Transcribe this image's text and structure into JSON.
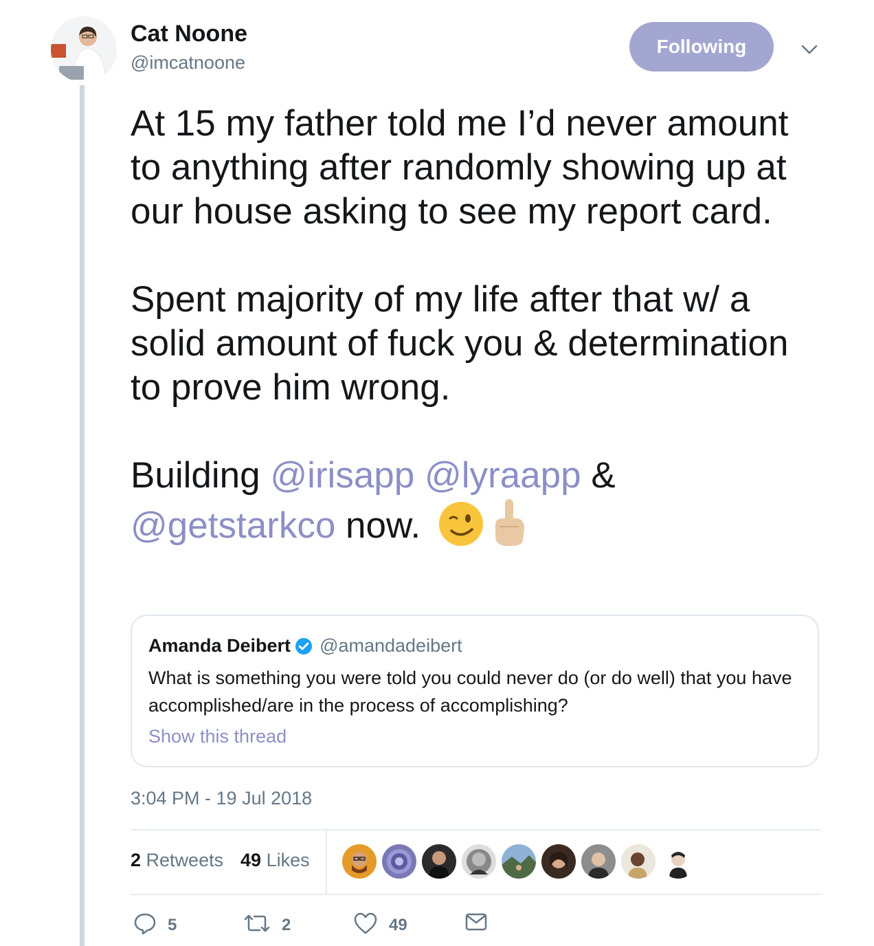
{
  "author": {
    "name": "Cat Noone",
    "handle": "@imcatnoone",
    "follow_label": "Following"
  },
  "tweet": {
    "paragraph1": "At 15 my father told me I’d never amount to anything after randomly showing up at our house asking to see my report card.",
    "paragraph2": "Spent majority of my life after that w/ a solid amount of fuck you & determination to prove him wrong.",
    "paragraph3": {
      "prefix": "Building ",
      "mention1": "@irisapp",
      "mention2": "@lyraapp",
      "joiner": " & ",
      "mention3": "@getstarkco",
      "suffix": " now. "
    },
    "emojis": [
      "winking-face-emoji",
      "middle-finger-emoji"
    ]
  },
  "quoted_tweet": {
    "name": "Amanda Deibert",
    "handle": "@amandadeibert",
    "text": "What is something you were told you could never do (or do well) that you have accomplished/are in the process of accomplishing?",
    "link_label": "Show this thread"
  },
  "timestamp": "3:04 PM - 19 Jul 2018",
  "stats": {
    "retweets_count": "2",
    "retweets_label": "Retweets",
    "likes_count": "49",
    "likes_label": "Likes"
  },
  "actions": {
    "reply_count": "5",
    "retweet_count": "2",
    "like_count": "49"
  },
  "colors": {
    "accent": "#8c8fc6",
    "follow_button": "#a3a6d1",
    "thread_line": "#ccd6dd",
    "secondary_text": "#657786"
  }
}
